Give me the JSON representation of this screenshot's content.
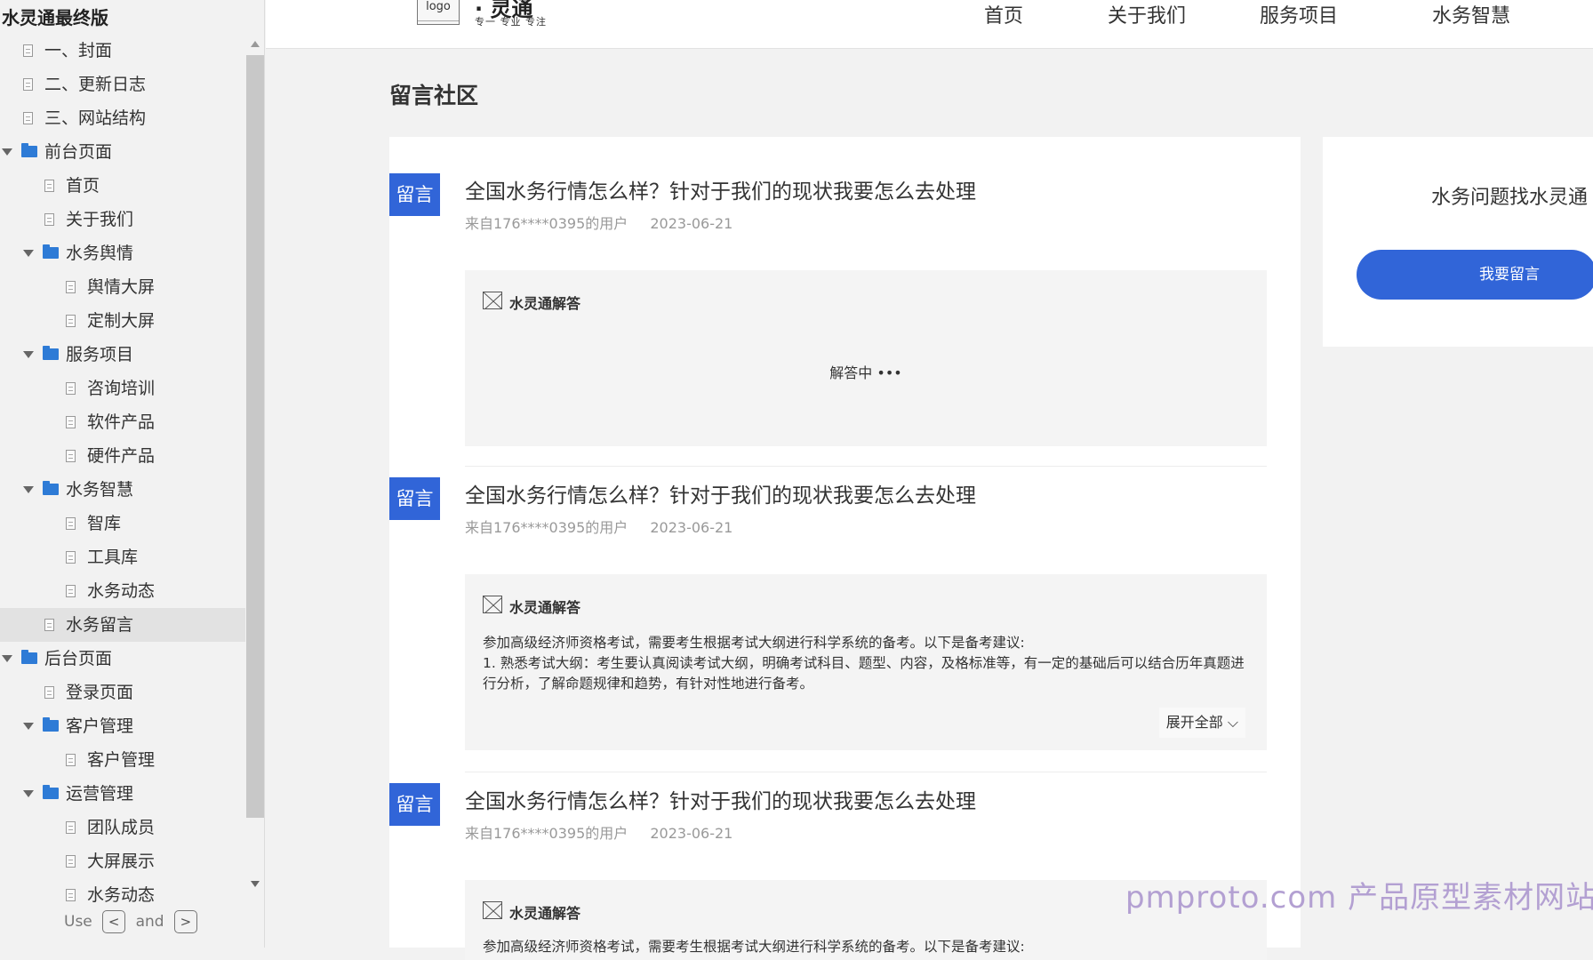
{
  "sidebar": {
    "title": "水灵通最终版",
    "items": [
      {
        "label": "一、封面",
        "level": 0,
        "type": "page"
      },
      {
        "label": "二、更新日志",
        "level": 0,
        "type": "page"
      },
      {
        "label": "三、网站结构",
        "level": 0,
        "type": "page"
      },
      {
        "label": "前台页面",
        "level": 0,
        "type": "folder"
      },
      {
        "label": "首页",
        "level": 1,
        "type": "page"
      },
      {
        "label": "关于我们",
        "level": 1,
        "type": "page"
      },
      {
        "label": "水务舆情",
        "level": 1,
        "type": "folder"
      },
      {
        "label": "舆情大屏",
        "level": 2,
        "type": "page"
      },
      {
        "label": "定制大屏",
        "level": 2,
        "type": "page"
      },
      {
        "label": "服务项目",
        "level": 1,
        "type": "folder"
      },
      {
        "label": "咨询培训",
        "level": 2,
        "type": "page"
      },
      {
        "label": "软件产品",
        "level": 2,
        "type": "page"
      },
      {
        "label": "硬件产品",
        "level": 2,
        "type": "page"
      },
      {
        "label": "水务智慧",
        "level": 1,
        "type": "folder"
      },
      {
        "label": "智库",
        "level": 2,
        "type": "page"
      },
      {
        "label": "工具库",
        "level": 2,
        "type": "page"
      },
      {
        "label": "水务动态",
        "level": 2,
        "type": "page"
      },
      {
        "label": "水务留言",
        "level": 1,
        "type": "page",
        "selected": true
      },
      {
        "label": "后台页面",
        "level": 0,
        "type": "folder"
      },
      {
        "label": "登录页面",
        "level": 1,
        "type": "page"
      },
      {
        "label": "客户管理",
        "level": 1,
        "type": "folder"
      },
      {
        "label": "客户管理",
        "level": 2,
        "type": "page"
      },
      {
        "label": "运营管理",
        "level": 1,
        "type": "folder"
      },
      {
        "label": "团队成员",
        "level": 2,
        "type": "page"
      },
      {
        "label": "大屏展示",
        "level": 2,
        "type": "page"
      },
      {
        "label": "水务动态",
        "level": 2,
        "type": "page"
      }
    ],
    "nav_hint": {
      "prefix": "Use",
      "key1": "<",
      "middle": "and",
      "key2": ">"
    }
  },
  "header": {
    "logo_text": "logo",
    "brand_mark": "· 灵通",
    "slogan": "专一 专业 专注",
    "nav": [
      "首页",
      "关于我们",
      "服务项目",
      "水务智慧"
    ]
  },
  "main": {
    "page_title": "留言社区",
    "posts": [
      {
        "badge": "留言",
        "title": "全国水务行情怎么样？针对于我们的现状我要怎么去处理",
        "user": "来自176****0395的用户",
        "date": "2023-06-21",
        "answer_label": "水灵通解答",
        "answer_status": "解答中 •••"
      },
      {
        "badge": "留言",
        "title": "全国水务行情怎么样？针对于我们的现状我要怎么去处理",
        "user": "来自176****0395的用户",
        "date": "2023-06-21",
        "answer_label": "水灵通解答",
        "answer_line1": "参加高级经济师资格考试，需要考生根据考试大纲进行科学系统的备考。以下是备考建议:",
        "answer_line2": "1. 熟悉考试大纲：考生要认真阅读考试大纲，明确考试科目、题型、内容，及格标准等，有一定的基础后可以结合历年真题进行分析，了解命题规律和趋势，有针对性地进行备考。",
        "expand_label": "展开全部 ⌵"
      },
      {
        "badge": "留言",
        "title": "全国水务行情怎么样？针对于我们的现状我要怎么去处理",
        "user": "来自176****0395的用户",
        "date": "2023-06-21",
        "answer_label": "水灵通解答",
        "answer_line1": "参加高级经济师资格考试，需要考生根据考试大纲进行科学系统的备考。以下是备考建议:"
      }
    ]
  },
  "right_card": {
    "hint": "水务问题找水灵通",
    "button_label": "我要留言"
  },
  "watermark": "pmproto.com 产品原型素材网站",
  "colors": {
    "accent": "#3165d8",
    "folder": "#2e7bd6",
    "watermark": "#b3a0d2"
  }
}
